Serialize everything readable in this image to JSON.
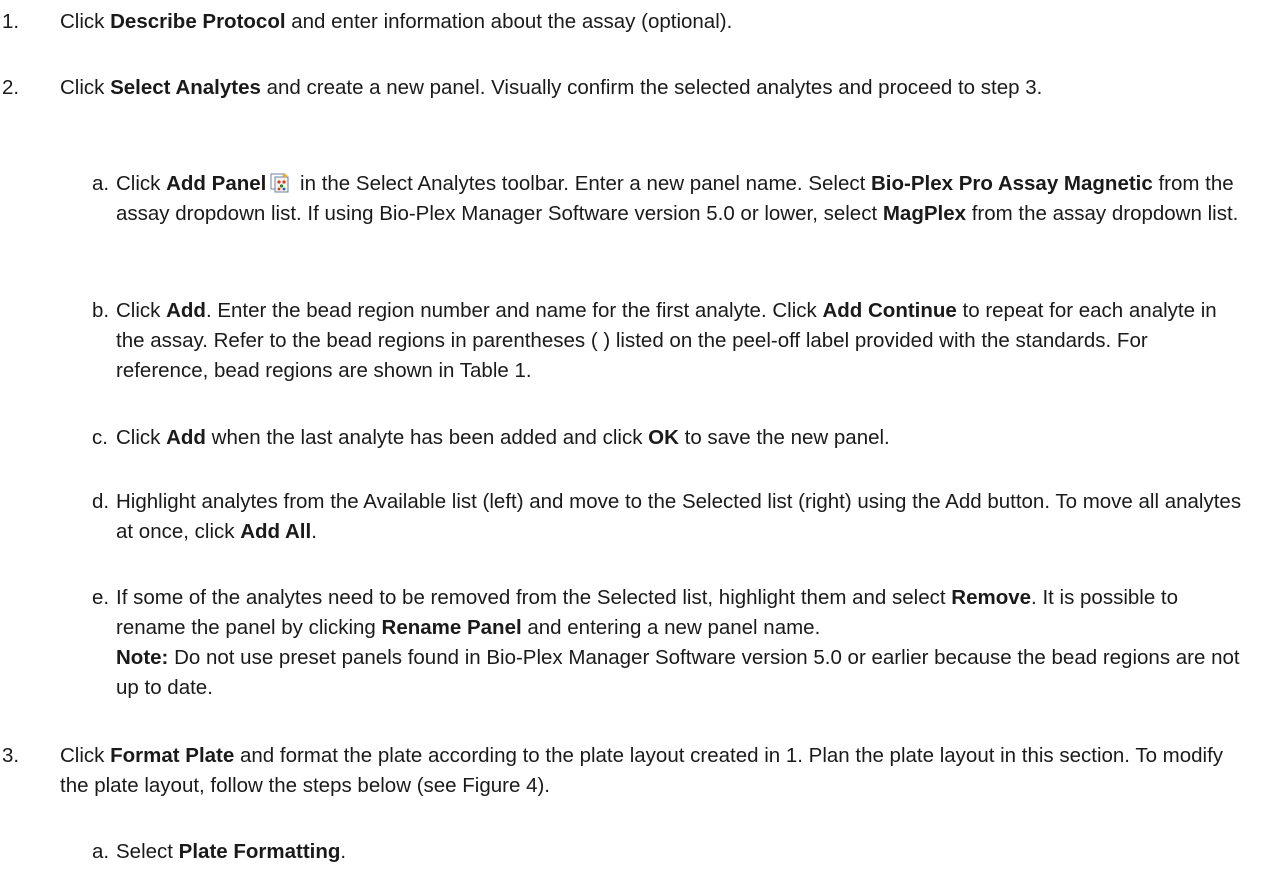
{
  "steps": [
    {
      "num": "1.",
      "pre": "Click ",
      "bold": "Describe Protocol",
      "post": " and enter information about the assay (optional)."
    },
    {
      "num": "2.",
      "pre": "Click ",
      "bold": "Select Analytes",
      "post": " and create a new panel. Visually confirm the selected analytes and proceed to step 3.",
      "subs": {
        "a": {
          "letter": "a.",
          "t1": "Click ",
          "b1": "Add Panel",
          "t2": " in the Select Analytes toolbar. Enter a new panel name. Select ",
          "b2": "Bio-Plex Pro Assay Magnetic",
          "t3": " from the assay dropdown list. If using Bio-Plex Manager Software version 5.0 or lower, select ",
          "b3": "MagPlex",
          "t4": " from the assay dropdown list.",
          "icon": "add-panel-icon"
        },
        "b": {
          "letter": "b.",
          "t1": "Click ",
          "b1": "Add",
          "t2": ". Enter the bead region number and name for the first analyte. Click ",
          "b2": "Add Continue",
          "t3": " to repeat for each analyte in the assay. Refer to the bead regions in parentheses ( ) listed on the peel-off label provided with the standards. For reference, bead regions are shown in Table 1."
        },
        "c": {
          "letter": "c.",
          "t1": "Click ",
          "b1": "Add",
          "t2": " when the last analyte has been added and click ",
          "b2": "OK",
          "t3": " to save the new panel."
        },
        "d": {
          "letter": "d.",
          "t1": "Highlight analytes from the Available list (left) and move to the Selected list (right) using the Add button. To move all analytes at once, click ",
          "b1": "Add All",
          "t2": "."
        },
        "e": {
          "letter": "e.",
          "t1": "If some of the analytes need to be removed from the Selected list, highlight them and select ",
          "b1": "Remove",
          "t2": ". It is possible to rename the panel by clicking ",
          "b2": "Rename Panel",
          "t3": " and entering a new panel name.",
          "note_label": "Note:",
          "note_text": " Do not use preset panels found in Bio-Plex Manager Software version 5.0  or earlier because the bead regions are not up to date."
        }
      }
    },
    {
      "num": "3.",
      "pre": "Click ",
      "bold": "Format Plate",
      "post": " and format the plate according to the plate layout created in 1. Plan the plate layout in this section. To modify the plate layout, follow the steps below (see Figure 4).",
      "subs": {
        "a": {
          "letter": "a.",
          "t1": "Select ",
          "b1": "Plate Formatting",
          "t2": "."
        }
      }
    }
  ]
}
